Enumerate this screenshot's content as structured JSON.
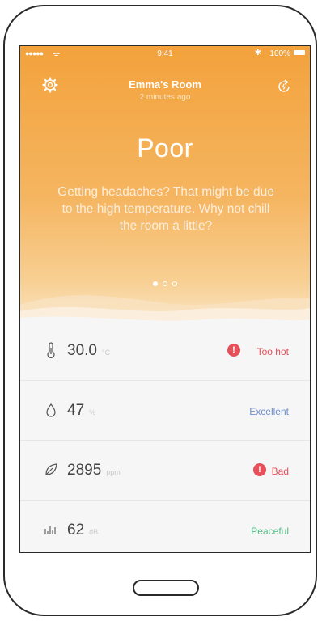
{
  "status_bar": {
    "signal": "●●●●●",
    "wifi": "ᯤ",
    "time": "9:41",
    "bluetooth": "✱",
    "battery": "100%"
  },
  "header": {
    "room_name": "Emma's Room",
    "updated": "2 minutes ago"
  },
  "summary": {
    "quality": "Poor",
    "message": "Getting headaches? That might be due to the high temperature. Why not chill the room a little?",
    "page_count": 3,
    "active_page": 1
  },
  "metrics": [
    {
      "icon": "thermometer-icon",
      "value": "30.0",
      "unit": "°C",
      "status": "Too hot",
      "alert": true,
      "color": "#e5505a"
    },
    {
      "icon": "humidity-drop-icon",
      "value": "47",
      "unit": "%",
      "status": "Excellent",
      "alert": false,
      "color": "#6f8fcf"
    },
    {
      "icon": "leaf-icon",
      "value": "2895",
      "unit": "ppm",
      "status": "Bad",
      "alert": true,
      "color": "#e5505a"
    },
    {
      "icon": "noise-bars-icon",
      "value": "62",
      "unit": "dB",
      "status": "Peaceful",
      "alert": false,
      "color": "#4fbf87"
    }
  ],
  "colors": {
    "accent": "#f3a23c",
    "alert": "#e5505a"
  }
}
